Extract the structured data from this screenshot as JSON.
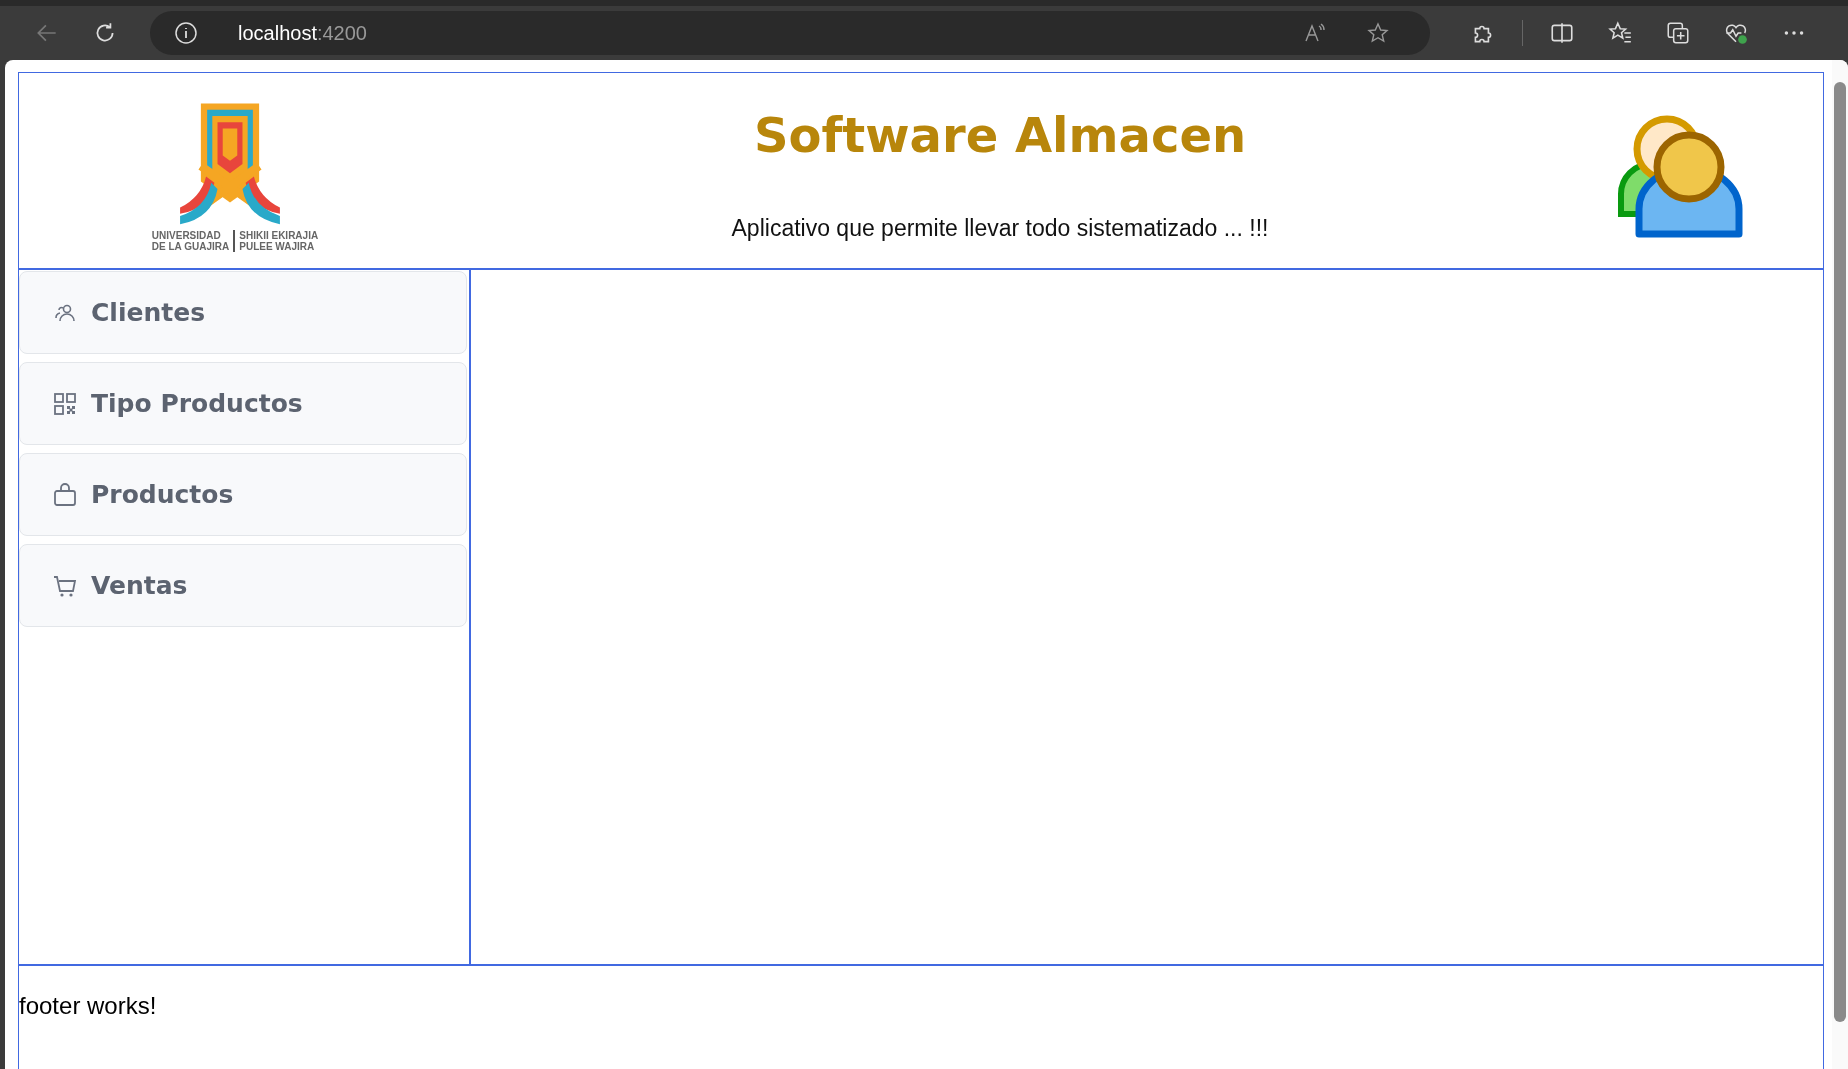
{
  "browser": {
    "url_host": "localhost",
    "url_port": ":4200"
  },
  "header": {
    "logo_lines": [
      {
        "left": "UNIVERSIDAD",
        "right": "SHIKII EKIRAJIA"
      },
      {
        "left": "DE LA GUAJIRA",
        "right": "PULEE  WAJIRA"
      }
    ],
    "title": "Software Almacen",
    "subtitle": "Aplicativo que permite llevar todo sistematizado ... !!!"
  },
  "sidebar": {
    "items": [
      {
        "label": "Clientes"
      },
      {
        "label": "Tipo Productos"
      },
      {
        "label": "Productos"
      },
      {
        "label": "Ventas"
      }
    ]
  },
  "footer": {
    "text": "footer works!"
  }
}
